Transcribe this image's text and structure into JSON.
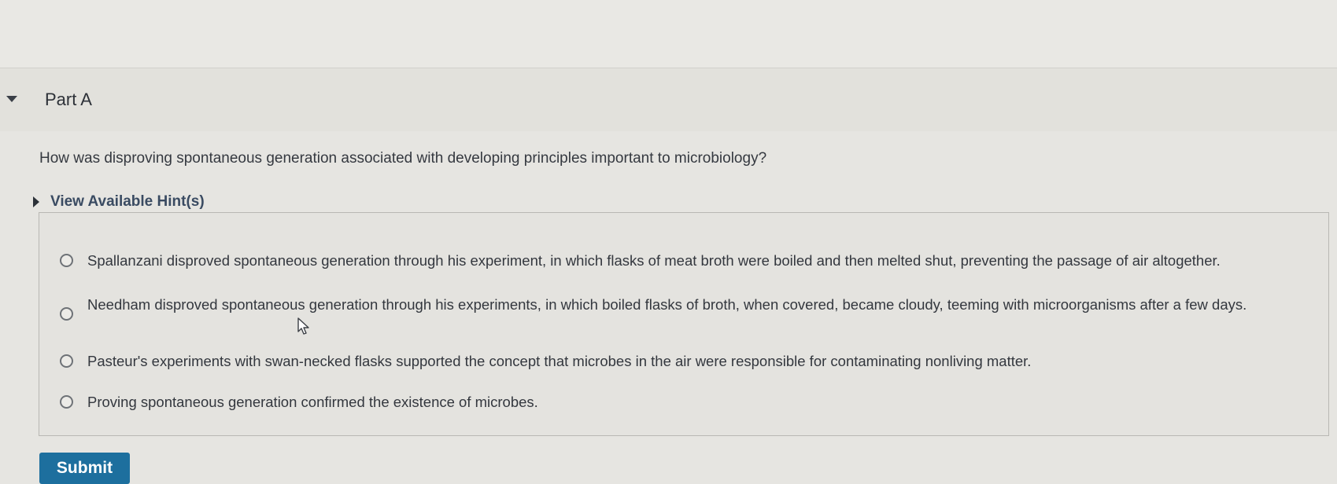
{
  "part": {
    "title": "Part A"
  },
  "question": {
    "text": "How was disproving spontaneous generation associated with developing principles important to microbiology?"
  },
  "hints": {
    "label": "View Available Hint(s)"
  },
  "choices": [
    {
      "text": "Spallanzani disproved spontaneous generation through his experiment, in which flasks of meat broth were boiled and then melted shut, preventing the passage of air altogether.",
      "selected": false
    },
    {
      "text": "Needham disproved spontaneous generation through his experiments, in which boiled flasks of broth, when covered, became cloudy, teeming with microorganisms after a few days.",
      "selected": false
    },
    {
      "text": "Pasteur's experiments with swan-necked flasks supported the concept that microbes in the air were responsible for contaminating nonliving matter.",
      "selected": false
    },
    {
      "text": "Proving spontaneous generation confirmed the existence of microbes.",
      "selected": false
    }
  ],
  "submit": {
    "label": "Submit"
  },
  "colors": {
    "submit_bg": "#1d6f9e",
    "hint_text": "#3a4b62"
  },
  "icons": {
    "collapse": "caret-down-icon",
    "expand_hints": "caret-right-icon",
    "pointer": "mouse-cursor-icon"
  }
}
